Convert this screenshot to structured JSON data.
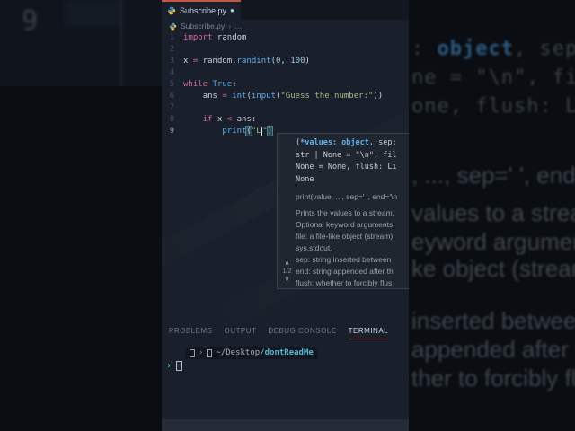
{
  "window": {
    "tab": {
      "label": "Subscribe.py",
      "modified_dot": "●",
      "icon": "python-icon"
    },
    "breadcrumb": {
      "file": "Subscribe.py",
      "separator": "›",
      "more": "…"
    }
  },
  "colors": {
    "accent_tab_top": "#c05740",
    "panel_active_underline": "#ad564c",
    "keyword_pink": "#d3699b",
    "function_blue": "#61afef",
    "string_green": "#9cbd85",
    "terminal_dir_cyan": "#57b7d9",
    "prompt_green": "#43c96f",
    "editor_bg": "#1a202b"
  },
  "code": {
    "lines": [
      {
        "num": "1",
        "tokens": [
          {
            "t": "import",
            "c": "kw"
          },
          {
            "t": " random",
            "c": "def"
          }
        ]
      },
      {
        "num": "2",
        "tokens": []
      },
      {
        "num": "3",
        "tokens": [
          {
            "t": "x ",
            "c": "def"
          },
          {
            "t": "= ",
            "c": "kw"
          },
          {
            "t": "random",
            "c": "def"
          },
          {
            "t": ".",
            "c": "def"
          },
          {
            "t": "randint",
            "c": "fn"
          },
          {
            "t": "(",
            "c": "def"
          },
          {
            "t": "0",
            "c": "num"
          },
          {
            "t": ", ",
            "c": "def"
          },
          {
            "t": "100",
            "c": "num"
          },
          {
            "t": ")",
            "c": "def"
          }
        ]
      },
      {
        "num": "4",
        "tokens": []
      },
      {
        "num": "5",
        "tokens": [
          {
            "t": "while",
            "c": "kw"
          },
          {
            "t": " ",
            "c": "def"
          },
          {
            "t": "True",
            "c": "const"
          },
          {
            "t": ":",
            "c": "def"
          }
        ]
      },
      {
        "num": "6",
        "tokens": [
          {
            "t": "    ",
            "c": "def"
          },
          {
            "t": "ans ",
            "c": "def"
          },
          {
            "t": "= ",
            "c": "kw"
          },
          {
            "t": "int",
            "c": "fn"
          },
          {
            "t": "(",
            "c": "def"
          },
          {
            "t": "input",
            "c": "fn"
          },
          {
            "t": "(",
            "c": "def"
          },
          {
            "t": "\"Guess the number:\"",
            "c": "str"
          },
          {
            "t": "))",
            "c": "def"
          }
        ]
      },
      {
        "num": "7",
        "tokens": []
      },
      {
        "num": "8",
        "tokens": [
          {
            "t": "    ",
            "c": "def"
          },
          {
            "t": "if",
            "c": "kw"
          },
          {
            "t": " x ",
            "c": "def"
          },
          {
            "t": "<",
            "c": "kw"
          },
          {
            "t": " ans",
            "c": "def"
          },
          {
            "t": ":",
            "c": "def"
          }
        ]
      },
      {
        "num": "9",
        "tokens": [
          {
            "t": "        ",
            "c": "def"
          },
          {
            "t": "print",
            "c": "fn"
          },
          {
            "t": "(",
            "c": "brk"
          },
          {
            "t": "\"L",
            "c": "str"
          },
          {
            "t": "",
            "c": "cur"
          },
          {
            "t": "\"",
            "c": "str"
          },
          {
            "t": ")",
            "c": "brk"
          }
        ]
      }
    ]
  },
  "tooltip": {
    "signature": {
      "open_paren": "(",
      "active_param": "*values: object",
      "rest": ", sep:",
      "line2": "str | None = \"\\n\", fil",
      "line3": "None = None, flush: Li",
      "line4": "None"
    },
    "doc_lines": {
      "code_line": "print(value, ..., sep=' ', end='\\n",
      "prints": "Prints the values to a stream,",
      "optional": "Optional keyword arguments:",
      "file": "file: a file-like object (stream);",
      "stdout": "sys.stdout.",
      "sep": "sep: string inserted between",
      "end": "end: string appended after th",
      "flush": "flush: whether to forcibly flus"
    },
    "pager": {
      "up": "∧",
      "count": "1/2",
      "down": "∨"
    }
  },
  "panel": {
    "tabs": [
      "PROBLEMS",
      "OUTPUT",
      "DEBUG CONSOLE",
      "TERMINAL"
    ],
    "active_tab": "TERMINAL"
  },
  "terminal": {
    "chevron1": "›",
    "path_prefix": "~/Desktop/",
    "path_dir": "dontReadMe",
    "prompt_chevron": "›"
  },
  "background": {
    "left_line_number": "9",
    "right_sig_parts": {
      "p0": ": ",
      "p1": "object",
      "p2": ", sep:"
    },
    "right_lines": {
      "r1": "ne = \"\\n\", fil",
      "r2": "one, flush: Li",
      "r3": ", ..., sep=' ', end='\\n",
      "r4": "values to a stream,",
      "r5": "eyword arguments:",
      "r6": "ke object (stream);",
      "r7": "inserted between",
      "r8": "appended after th",
      "r9": "ther to forcibly flus"
    }
  }
}
